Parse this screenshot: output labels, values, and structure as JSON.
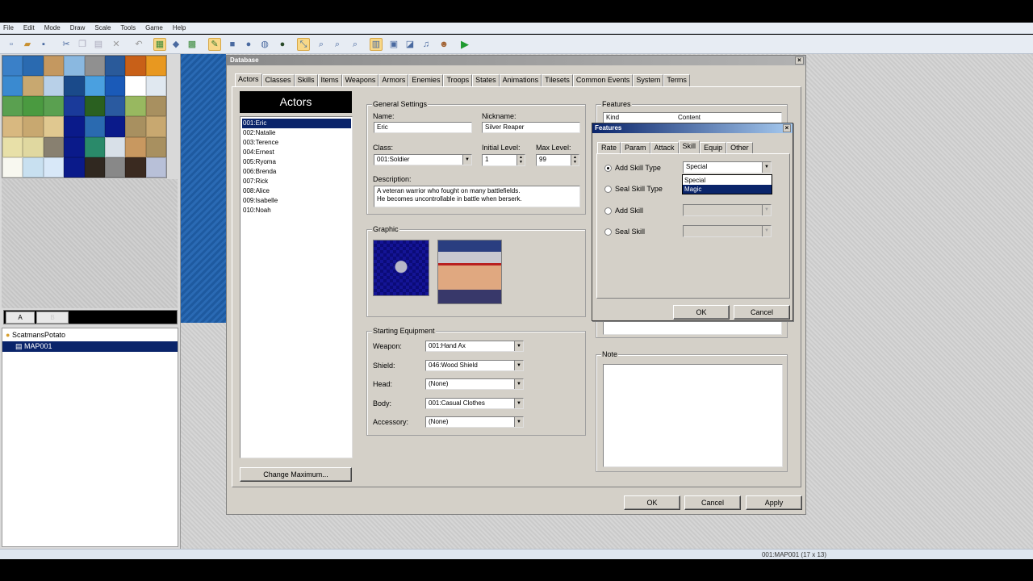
{
  "menu": [
    "File",
    "Edit",
    "Mode",
    "Draw",
    "Scale",
    "Tools",
    "Game",
    "Help"
  ],
  "toolbar_icons": [
    "new-icon",
    "open-icon",
    "save-icon",
    "cut-icon",
    "copy-icon",
    "paste-icon",
    "delete-icon",
    "undo-icon",
    "layer-map-icon",
    "layer-event-icon",
    "region-icon",
    "pencil-icon",
    "rectangle-icon",
    "ellipse-icon",
    "flood-fill-icon",
    "shadow-pen-icon",
    "select-icon",
    "zoom-1-icon",
    "zoom-2-icon",
    "zoom-4-icon",
    "database-icon",
    "resource-manager-icon",
    "script-editor-icon",
    "sound-test-icon",
    "character-generator-icon",
    "playtest-icon"
  ],
  "tileset_tabs": [
    "A",
    "B"
  ],
  "map_tree": {
    "project": "ScatmansPotato",
    "maps": [
      "MAP001"
    ]
  },
  "statusbar": {
    "text": "001:MAP001 (17 x 13)"
  },
  "database": {
    "title": "Database",
    "close": "×",
    "tabs": [
      "Actors",
      "Classes",
      "Skills",
      "Items",
      "Weapons",
      "Armors",
      "Enemies",
      "Troops",
      "States",
      "Animations",
      "Tilesets",
      "Common Events",
      "System",
      "Terms"
    ],
    "active_tab": "Actors",
    "actors_header": "Actors",
    "actors": [
      "001:Eric",
      "002:Natalie",
      "003:Terence",
      "004:Ernest",
      "005:Ryoma",
      "006:Brenda",
      "007:Rick",
      "008:Alice",
      "009:Isabelle",
      "010:Noah"
    ],
    "selected_actor": "001:Eric",
    "change_max": "Change Maximum...",
    "general": {
      "title": "General Settings",
      "name_label": "Name:",
      "name": "Eric",
      "nickname_label": "Nickname:",
      "nickname": "Silver Reaper",
      "class_label": "Class:",
      "class": "001:Soldier",
      "initial_level_label": "Initial Level:",
      "initial_level": "1",
      "max_level_label": "Max Level:",
      "max_level": "99",
      "description_label": "Description:",
      "description": "A veteran warrior who fought on many battlefields.\nHe becomes uncontrollable in battle when berserk."
    },
    "graphic": {
      "title": "Graphic"
    },
    "equipment": {
      "title": "Starting Equipment",
      "rows": [
        {
          "label": "Weapon:",
          "value": "001:Hand Ax"
        },
        {
          "label": "Shield:",
          "value": "046:Wood Shield"
        },
        {
          "label": "Head:",
          "value": "(None)"
        },
        {
          "label": "Body:",
          "value": "001:Casual Clothes"
        },
        {
          "label": "Accessory:",
          "value": "(None)"
        }
      ]
    },
    "features": {
      "title": "Features",
      "col_kind": "Kind",
      "col_content": "Content"
    },
    "note": {
      "title": "Note"
    },
    "buttons": {
      "ok": "OK",
      "cancel": "Cancel",
      "apply": "Apply"
    }
  },
  "features_dialog": {
    "title": "Features",
    "close": "×",
    "tabs": [
      "Rate",
      "Param",
      "Attack",
      "Skill",
      "Equip",
      "Other"
    ],
    "active_tab": "Skill",
    "options": [
      {
        "label": "Add Skill Type",
        "checked": true,
        "value": "Special"
      },
      {
        "label": "Seal Skill Type",
        "checked": false,
        "value": ""
      },
      {
        "label": "Add Skill",
        "checked": false,
        "value": ""
      },
      {
        "label": "Seal Skill",
        "checked": false,
        "value": ""
      }
    ],
    "dropdown_options": [
      "Special",
      "Magic"
    ],
    "dropdown_highlighted": "Magic",
    "ok": "OK",
    "cancel": "Cancel"
  },
  "colors": {
    "selection": "#0a246a",
    "window_face": "#d4d0c8",
    "water": "#1e5aa0"
  }
}
